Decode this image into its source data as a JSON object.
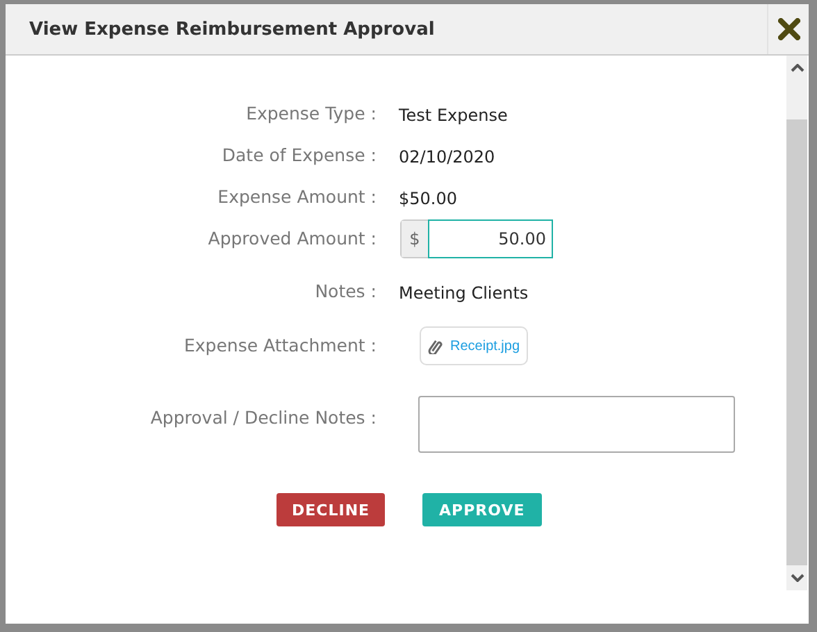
{
  "dialog": {
    "title": "View Expense Reimbursement Approval"
  },
  "fields": [
    {
      "kind": "text",
      "label": "Expense Type :",
      "value": "Test Expense"
    },
    {
      "kind": "text",
      "label": "Date of Expense :",
      "value": "02/10/2020"
    },
    {
      "kind": "text",
      "label": "Expense Amount :",
      "value": "$50.00"
    },
    {
      "kind": "amount",
      "label": "Approved Amount :",
      "prefix": "$",
      "value": "50.00"
    },
    {
      "kind": "text",
      "label": "Notes :",
      "value": "Meeting Clients"
    },
    {
      "kind": "attachment",
      "label": "Expense Attachment :",
      "value": "Receipt.jpg"
    },
    {
      "kind": "textarea",
      "label": "Approval / Decline Notes :"
    }
  ],
  "buttons": [
    {
      "label": "DECLINE",
      "kind": "danger"
    },
    {
      "label": "APPROVE",
      "kind": "success"
    }
  ]
}
